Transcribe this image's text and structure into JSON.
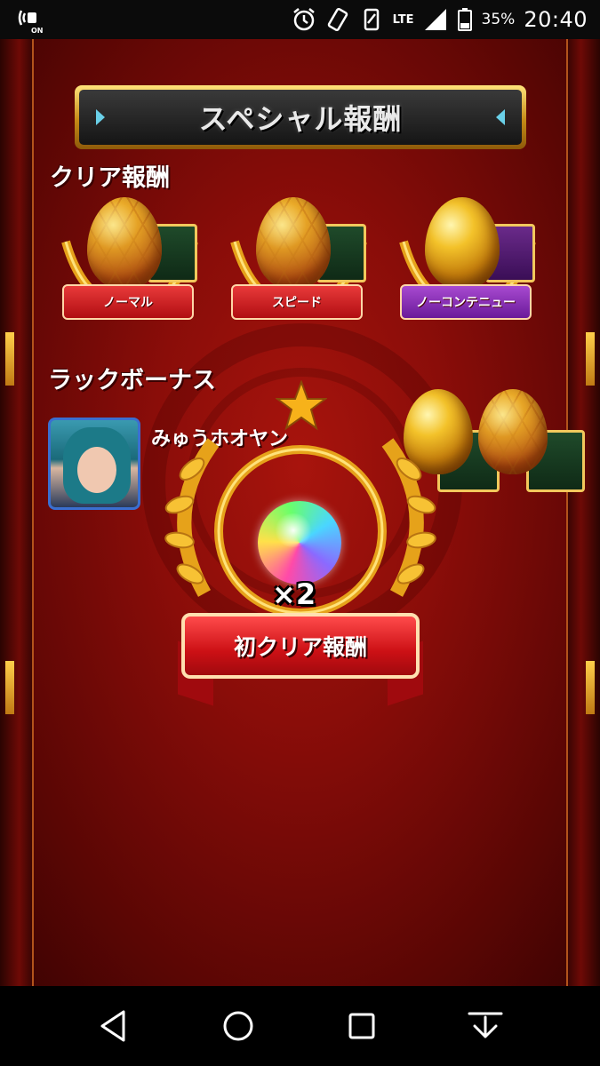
{
  "status_bar": {
    "left_icon": "nfc-on-icon",
    "left_label": "ON",
    "alarm_icon": "alarm-icon",
    "rotate_icon": "screen-rotate-icon",
    "vibrate_icon": "vibrate-icon",
    "network": "LTE",
    "signal_icon": "signal-bars-icon",
    "battery_icon": "battery-icon",
    "battery_percent": "35%",
    "time": "20:40"
  },
  "screen": {
    "title": "スペシャル報酬",
    "clear_rewards_label": "クリア報酬",
    "clear_rewards": [
      {
        "label": "ノーマル",
        "egg": "hex-gold-egg",
        "box": "green-treasure-box",
        "color": "#cc1418"
      },
      {
        "label": "スピード",
        "egg": "hex-gold-egg",
        "box": "green-treasure-box",
        "color": "#cc1418"
      },
      {
        "label": "ノーコンテニュー",
        "egg": "gold-egg",
        "box": "purple-treasure-box",
        "color": "#7a22a8"
      }
    ],
    "luck_bonus_label": "ラックボーナス",
    "luck_bonus_player": "みゅうホオヤン",
    "luck_bonus_eggs": [
      "gold-egg",
      "hex-gold-egg"
    ]
  },
  "popup": {
    "item_icon": "rainbow-orb-icon",
    "multiplier": "×2",
    "ribbon_label": "初クリア報酬",
    "star_icon": "star-icon"
  },
  "nav_bar": {
    "back_icon": "back-triangle-icon",
    "home_icon": "home-circle-icon",
    "recents_icon": "recents-square-icon",
    "extra_icon": "hide-nav-arrow-icon"
  }
}
